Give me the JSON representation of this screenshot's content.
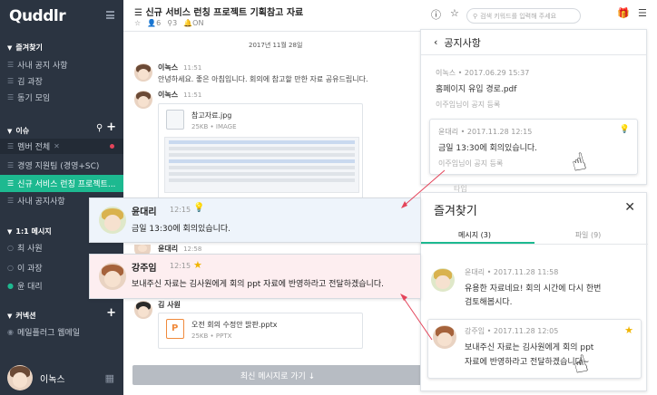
{
  "sidebar": {
    "logo": "Quddlr",
    "favorites_header": "즐겨찾기",
    "favorites": [
      "사내 공지 사항",
      "김 과장",
      "동기 모임"
    ],
    "issues_header": "이슈",
    "issues": [
      "멤버 전체",
      "경영 지원팀 (경영+SC)",
      "신규 서비스 런칭 프로젝트...",
      "사내 공지사항"
    ],
    "dm_header": "1:1 메시지",
    "dms": [
      "최 사원",
      "이 과장",
      "윤 대리"
    ],
    "connect_header": "커넥션",
    "connect": [
      "메일플러그 웹메일"
    ],
    "user_name": "이녹스"
  },
  "channel": {
    "title": "신규 서비스 런칭 프로젝트 기획참고 자료",
    "members": "6",
    "pins": "3",
    "status": "ON",
    "date": "2017년 11월 28일"
  },
  "messages": [
    {
      "name": "이녹스",
      "time": "11:51",
      "text": "안녕하세요. 좋은 아침입니다. 회의에 참고할 만한 자료 공유드립니다."
    },
    {
      "name": "이녹스",
      "time": "11:51",
      "file": {
        "title": "참고자료.jpg",
        "meta": "25KB • IMAGE"
      }
    },
    {
      "name": "김 사원",
      "time": "",
      "file": {
        "title": "오전 회의 수정안 밝판.pptx",
        "meta": "25KB • PPTX"
      }
    }
  ],
  "callout1": {
    "name": "윤대리",
    "time": "12:15",
    "text": "금일 13:30에 회의있습니다."
  },
  "callout2": {
    "name": "강주임",
    "time": "12:15",
    "text": "보내주신 자료는 김사원에게 회의 ppt 자료에 반영하라고 전달하겠습니다."
  },
  "hidden_row": {
    "name": "윤대리",
    "time": "12:58"
  },
  "goto_latest": "최신 메시지로 가기 ↓",
  "search": {
    "placeholder": "검색 키워드를 입력해 주세요"
  },
  "notice_panel": {
    "title": "공지사항",
    "items": [
      {
        "meta": "이녹스 • 2017.06.29 15:37",
        "text": "홈페이지 유입 경로.pdf",
        "sub": "이주임님이 공지 등록"
      },
      {
        "meta": "윤대리 • 2017.11.28 12:15",
        "text": "금일 13:30에 회의있습니다.",
        "sub": "이주임님이 공지 등록"
      }
    ]
  },
  "fav_panel": {
    "title": "즐겨찾기",
    "tabs": [
      "메시지 (3)",
      "파일 (9)"
    ],
    "items": [
      {
        "meta": "윤대리 • 2017.11.28 11:58",
        "lines": [
          "유용한 자료네요! 회의 시간에 다시 한번",
          "검토해봅시다."
        ]
      },
      {
        "meta": "강주임 • 2017.11.28 12:05",
        "lines": [
          "보내주신 자료는 김사원에게 회의 ppt",
          "자료에 반영하라고 전달하겠습니다~"
        ]
      }
    ]
  },
  "peek_label": "타입",
  "colors": {
    "sidebar": "#2b3441",
    "accent": "#1db990",
    "alert": "#e4445a",
    "star": "#f0b400"
  }
}
